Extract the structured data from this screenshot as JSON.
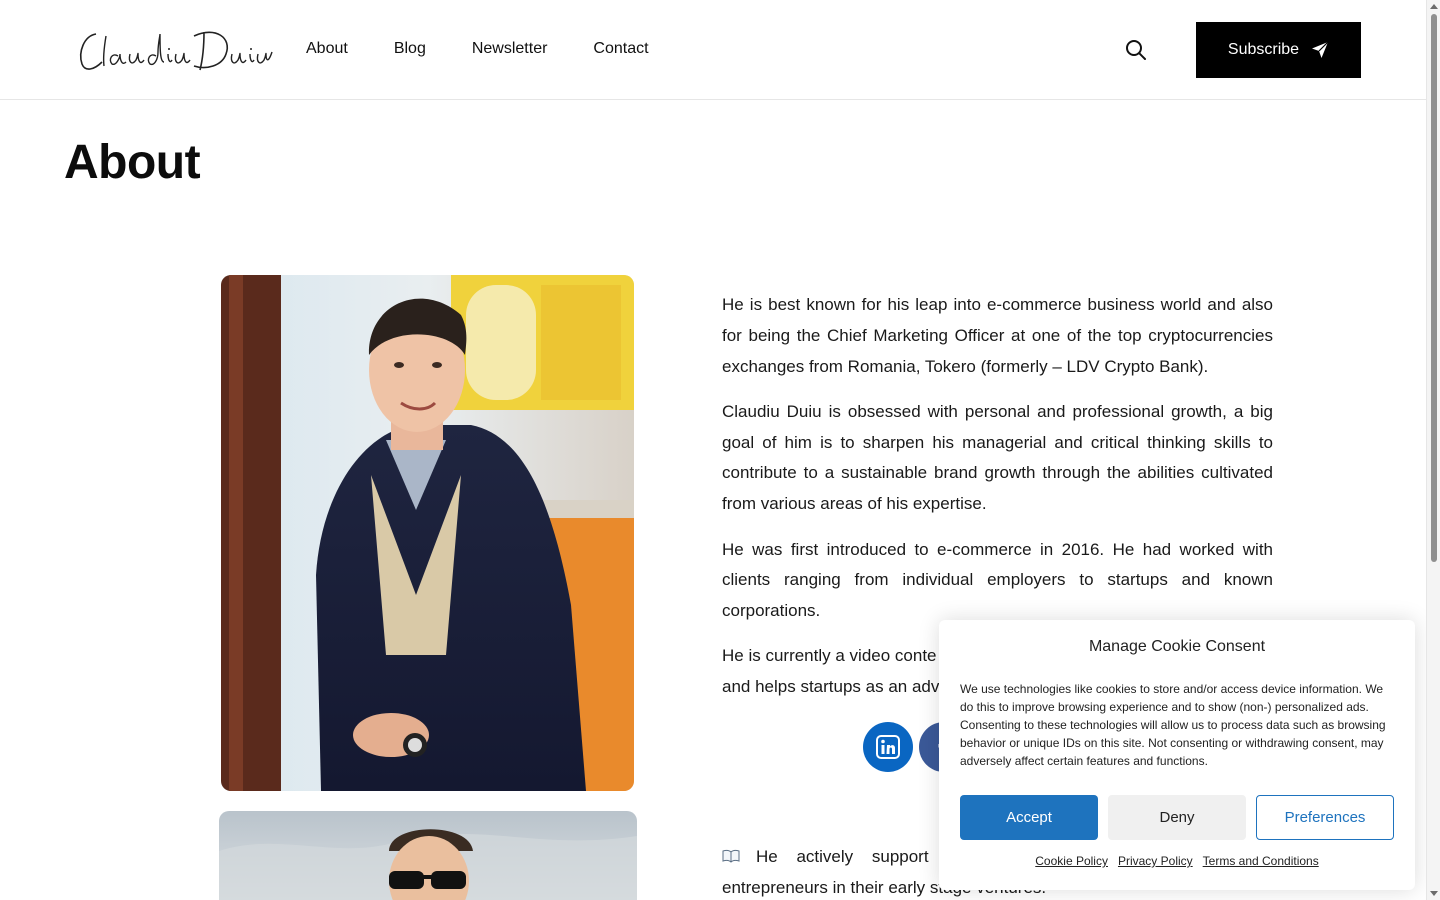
{
  "header": {
    "logo_text": "Claudiu Duiu",
    "nav": [
      {
        "label": "About"
      },
      {
        "label": "Blog"
      },
      {
        "label": "Newsletter"
      },
      {
        "label": "Contact"
      }
    ],
    "subscribe_label": "Subscribe"
  },
  "page": {
    "title": "About"
  },
  "content": {
    "paragraphs": [
      "He is best known for his leap into e-commerce business world and also for being the Chief Marketing Officer at one of the top cryptocurrencies exchanges from Romania, Tokero (formerly – LDV Crypto Bank).",
      "Claudiu Duiu is obsessed with personal and professional growth, a big goal of him is to sharpen his managerial and critical thinking skills to contribute to a sustainable brand growth through the abilities cultivated from various areas of his expertise.",
      "He was first introduced to e-commerce in 2016. He had worked with clients ranging from individual employers to startups and known corporations.",
      "He is currently a video conte",
      "and helps startups as an advis"
    ],
    "bottom_line1": "He actively support",
    "bottom_line2": "entrepreneurs in their early stage ventures."
  },
  "social": [
    {
      "name": "linkedin-icon",
      "color": "#0a66c2"
    },
    {
      "name": "facebook-icon",
      "color": "#3b5998"
    }
  ],
  "cookie": {
    "title": "Manage Cookie Consent",
    "text": "We use technologies like cookies to store and/or access device information. We do this to improve browsing experience and to show (non-) personalized ads. Consenting to these technologies will allow us to process data such as browsing behavior or unique IDs on this site. Not consenting or withdrawing consent, may adversely affect certain features and functions.",
    "accept": "Accept",
    "deny": "Deny",
    "preferences": "Preferences",
    "links": [
      "Cookie Policy",
      "Privacy Policy",
      "Terms and Conditions"
    ],
    "accent_color": "#1e73be"
  }
}
